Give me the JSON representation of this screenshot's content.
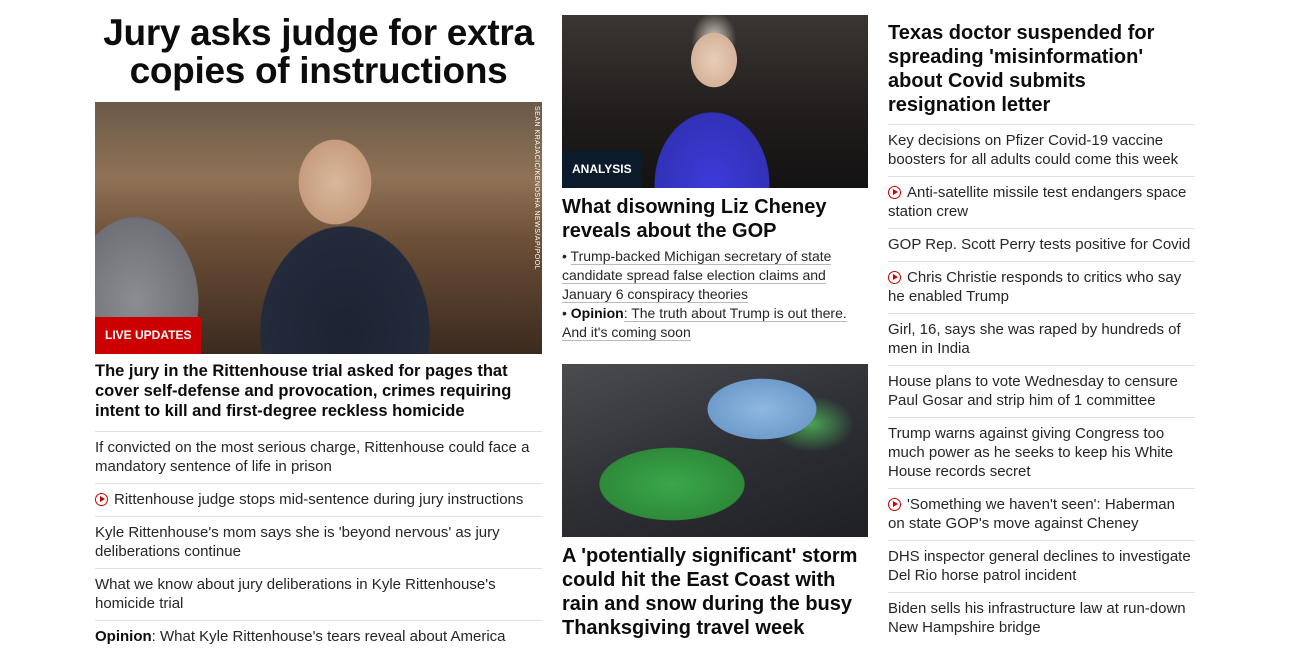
{
  "col1": {
    "headline": "Jury asks judge for extra copies of instructions",
    "hero_credit": "SEAN KRAJACIC/KENOSHA NEWS/AP/POOL",
    "hero_badge": "LIVE UPDATES",
    "lead": "The jury in the Rittenhouse trial asked for pages that cover self-defense and provocation, crimes requiring intent to kill and first-degree reckless homicide",
    "items": [
      {
        "text": "If convicted on the most serious charge, Rittenhouse could face a mandatory sentence of life in prison"
      },
      {
        "text": "Rittenhouse judge stops mid-sentence during jury instructions"
      },
      {
        "text": "Kyle Rittenhouse's mom says she is 'beyond nervous' as jury deliberations continue"
      },
      {
        "text": "What we know about jury deliberations in Kyle Rittenhouse's homicide trial"
      },
      {
        "prefix": "Opinion",
        "text": ": What Kyle Rittenhouse's tears reveal about America"
      }
    ]
  },
  "col2": {
    "badge": "ANALYSIS",
    "headline1": "What disowning Liz Cheney reveals about the GOP",
    "bullet1": "Trump-backed Michigan secretary of state candidate spread false election claims and January 6 conspiracy theories",
    "bullet2_prefix": "Opinion",
    "bullet2": ": The truth about Trump is out there. And it's coming soon",
    "headline2": "A 'potentially significant' storm could hit the East Coast with rain and snow during the busy Thanksgiving travel week"
  },
  "col3": {
    "headline": "Texas doctor suspended for spreading 'misinformation' about Covid submits resignation letter",
    "items": [
      {
        "text": "Key decisions on Pfizer Covid-19 vaccine boosters for all adults could come this week"
      },
      {
        "text": "Anti-satellite missile test endangers space station crew"
      },
      {
        "text": "GOP Rep. Scott Perry tests positive for Covid"
      },
      {
        "text": "Chris Christie responds to critics who say he enabled Trump"
      },
      {
        "text": "Girl, 16, says she was raped by hundreds of men in India"
      },
      {
        "text": "House plans to vote Wednesday to censure Paul Gosar and strip him of 1 committee"
      },
      {
        "text": "Trump warns against giving Congress too much power as he seeks to keep his White House records secret"
      },
      {
        "text": "'Something we haven't seen': Haberman on state GOP's move against Cheney"
      },
      {
        "text": "DHS inspector general declines to investigate Del Rio horse patrol incident"
      },
      {
        "text": "Biden sells his infrastructure law at run-down New Hampshire bridge"
      }
    ]
  },
  "icons": {
    "video": "play-circle-icon"
  },
  "colors": {
    "badge_red": "#cc0000",
    "badge_dark": "#0c1b2b",
    "divider": "#e0e0e0"
  }
}
